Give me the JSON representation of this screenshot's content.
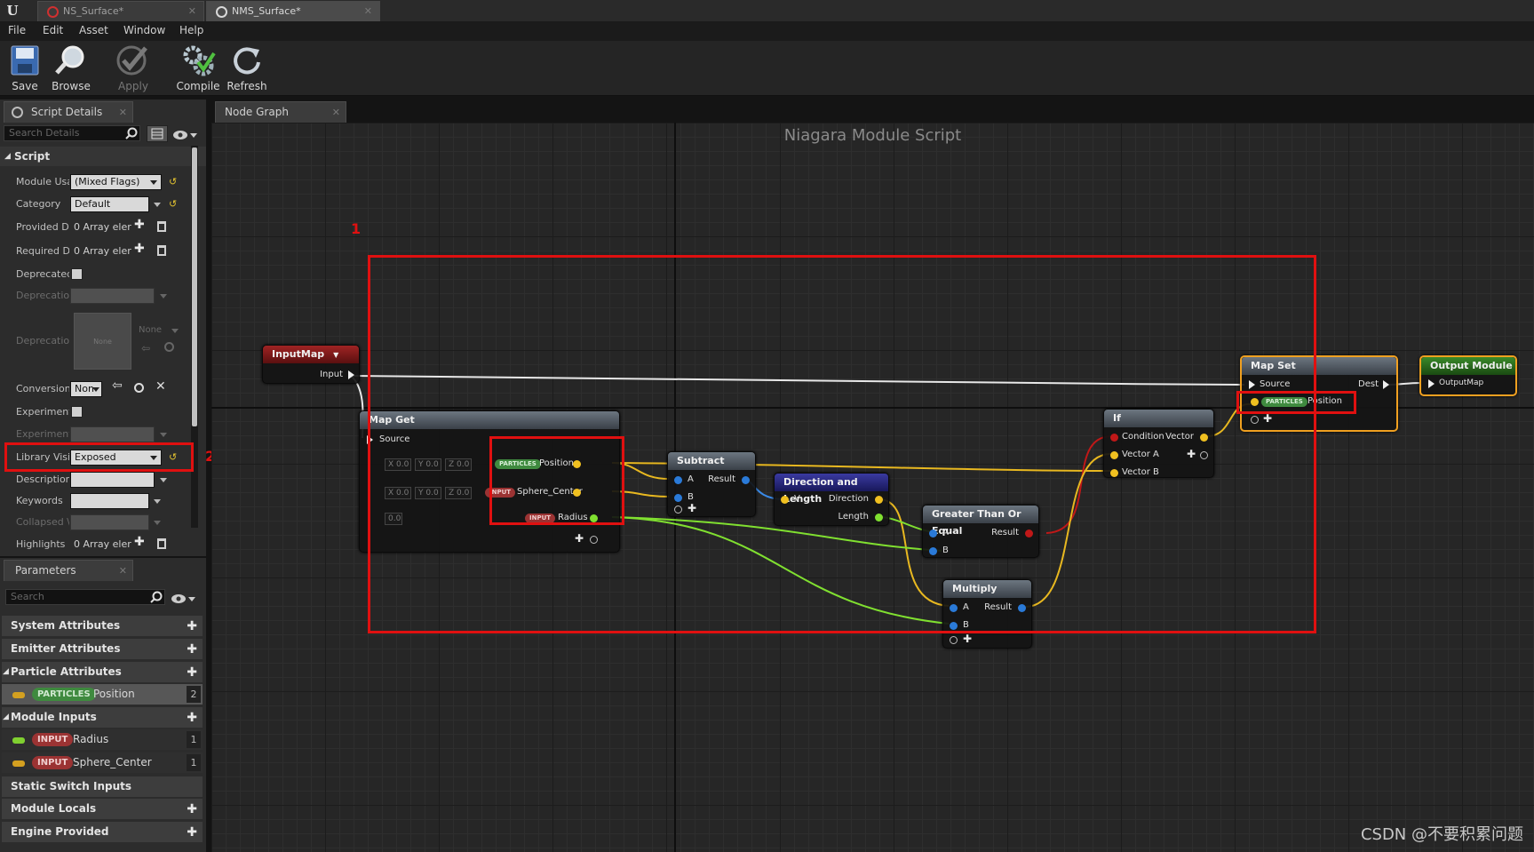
{
  "tabs": [
    {
      "label": "NS_Surface*"
    },
    {
      "label": "NMS_Surface*"
    }
  ],
  "menu": [
    "File",
    "Edit",
    "Asset",
    "Window",
    "Help"
  ],
  "toolbar": {
    "save": "Save",
    "browse": "Browse",
    "apply": "Apply",
    "compile": "Compile",
    "refresh": "Refresh"
  },
  "details": {
    "tab_label": "Script Details",
    "search_placeholder": "Search Details",
    "section": "Script",
    "props": {
      "module_usage": {
        "label": "Module Usa",
        "value": "(Mixed Flags)"
      },
      "category": {
        "label": "Category",
        "value": "Default"
      },
      "provided_dependencies": {
        "label": "Provided De",
        "value": "0 Array eler"
      },
      "required_dependencies": {
        "label": "Required De",
        "value": "0 Array eler"
      },
      "deprecated": {
        "label": "Deprecated"
      },
      "deprecation_message": {
        "label": "Deprecatio"
      },
      "deprecation_recommendation": {
        "label": "Deprecation",
        "thumb": "None",
        "value": "None"
      },
      "conversion": {
        "label": "Conversion",
        "value": "Non"
      },
      "experimental": {
        "label": "Experiment"
      },
      "experimental_message": {
        "label": "Experiment"
      },
      "library_visibility": {
        "label": "Library Visi",
        "value": "Exposed"
      },
      "description": {
        "label": "Descriptior"
      },
      "keywords": {
        "label": "Keywords"
      },
      "collapsed_view": {
        "label": "Collapsed \\"
      },
      "highlights": {
        "label": "Highlights",
        "value": "0 Array eler"
      }
    }
  },
  "parameters": {
    "tab_label": "Parameters",
    "search_placeholder": "Search",
    "categories": {
      "system": "System Attributes",
      "emitter": "Emitter Attributes",
      "particle": "Particle Attributes",
      "module_inputs": "Module Inputs",
      "static_switch": "Static Switch Inputs",
      "module_locals": "Module Locals",
      "engine": "Engine Provided"
    },
    "particle_items": [
      {
        "tag": "PARTICLES",
        "name": "Position",
        "count": "2",
        "color": "#d4a020"
      }
    ],
    "module_items": [
      {
        "tag": "INPUT",
        "name": "Radius",
        "count": "1",
        "color": "#80d030"
      },
      {
        "tag": "INPUT",
        "name": "Sphere_Center",
        "count": "1",
        "color": "#d4a020"
      }
    ]
  },
  "graph": {
    "tab_label": "Node Graph",
    "title": "Niagara Module Script",
    "annotation_1": "1",
    "annotation_2": "2",
    "nodes": {
      "input_map": {
        "title": "InputMap",
        "pin_input": "Input"
      },
      "map_get": {
        "title": "Map Get",
        "pin_source": "Source",
        "position_tag": "PARTICLES",
        "position": "Position",
        "sphere_tag": "INPUT",
        "sphere": "Sphere_Center",
        "radius_tag": "INPUT",
        "radius": "Radius",
        "x": "X",
        "y": "Y",
        "z": "Z",
        "default_value": "0.0"
      },
      "subtract": {
        "title": "Subtract",
        "a": "A",
        "b": "B",
        "result": "Result"
      },
      "direction": {
        "title": "Direction and Length",
        "v": "V",
        "direction": "Direction",
        "length": "Length"
      },
      "gte": {
        "title": "Greater Than Or Equal",
        "a": "A",
        "b": "B",
        "result": "Result"
      },
      "multiply": {
        "title": "Multiply",
        "a": "A",
        "b": "B",
        "result": "Result"
      },
      "if_node": {
        "title": "If",
        "condition": "Condition",
        "vector": "Vector",
        "vector_a": "Vector A",
        "vector_b": "Vector B"
      },
      "map_set": {
        "title": "Map Set",
        "source": "Source",
        "dest": "Dest",
        "position_tag": "PARTICLES",
        "position": "Position"
      },
      "output_module": {
        "title": "Output Module",
        "pin": "OutputMap"
      }
    }
  },
  "watermark": "CSDN @不要积累问题",
  "colors": {
    "annotation": "#e01010",
    "float_pin": "#80e030",
    "vector_pin": "#f0c020",
    "bool_pin": "#c01818",
    "numeric_pin": "#2a7ad8"
  }
}
